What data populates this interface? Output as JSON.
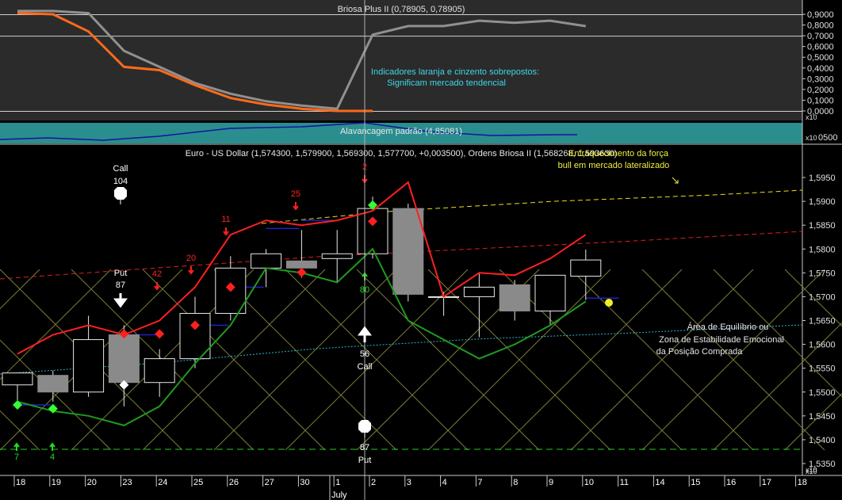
{
  "top_panel": {
    "title": "Briosa Plus II (0,78905, 0,78905)",
    "y_ticks": [
      "0,9000",
      "0,8000",
      "0,7000",
      "0,6000",
      "0,5000",
      "0,4000",
      "0,3000",
      "0,2000",
      "0,1000",
      "0,0000"
    ],
    "note_line1": "Indicadores laranja e cinzento sobrepostos:",
    "note_line2": "Significam mercado tendencial",
    "scale_tag": "x10"
  },
  "mid_panel": {
    "title": "Alavancagem padrão (4,85081)",
    "y_tick": "0500",
    "scale_tag": "x10"
  },
  "main_panel": {
    "title": "Euro - US Dollar (1,574300, 1,579900, 1,569300, 1,577700, +0,003500), Ordens Briosa II (1,568268, 1,593630)",
    "overlay_note_line1": "Enfraquecimento da força",
    "overlay_note_line2": "bull em mercado lateralizado",
    "zone_note_line1": "Área de Equilíbrio ou",
    "zone_note_line2": "Zona de Estabilidade Emocional",
    "zone_note_line3": "da Posição Comprada",
    "y_ticks": [
      "1,5950",
      "1,5900",
      "1,5850",
      "1,5800",
      "1,5750",
      "1,5700",
      "1,5650",
      "1,5600",
      "1,5550",
      "1,5500",
      "1,5450",
      "1,5400",
      "1,5350"
    ],
    "scale_tag": "x10",
    "signals": {
      "call_104_a": "Call",
      "call_104_b": "104",
      "put_87_a": "Put",
      "put_87_b": "87",
      "call_56_a": "56",
      "call_56_b": "Call",
      "put_87b_a": "87",
      "put_87b_b": "Put",
      "n7": "7",
      "n4": "4",
      "n80": "80",
      "n2": "2",
      "n11": "11",
      "n20": "20",
      "n25": "25",
      "n42": "42"
    }
  },
  "x_axis": {
    "labels": [
      "18",
      "19",
      "20",
      "23",
      "24",
      "25",
      "26",
      "27",
      "30",
      "1",
      "2",
      "3",
      "4",
      "7",
      "8",
      "9",
      "10",
      "11",
      "14",
      "15",
      "16",
      "17",
      "18"
    ],
    "month": "July",
    "scale_tag": "x10"
  },
  "colors": {
    "red_line": "#ff2020",
    "green_line": "#1f9a1f",
    "orange": "#ff6a1a",
    "gray": "#909090",
    "teal_band": "#1e8a8a",
    "blue_line": "#1a1aa0",
    "yellow": "#e8e020"
  },
  "chart_data": {
    "type": "candlestick",
    "title": "Euro - US Dollar (1,574300, 1,579900, 1,569300, 1,577700, +0,003500), Ordens Briosa II (1,568268, 1,593630)",
    "categories": [
      "18",
      "19",
      "20",
      "23",
      "24",
      "25",
      "26",
      "27",
      "30",
      "1",
      "2",
      "3",
      "4",
      "7",
      "8",
      "9",
      "10"
    ],
    "ohlc": [
      {
        "o": 1.5515,
        "h": 1.554,
        "l": 1.547,
        "c": 1.554
      },
      {
        "o": 1.5535,
        "h": 1.5545,
        "l": 1.548,
        "c": 1.55
      },
      {
        "o": 1.55,
        "h": 1.566,
        "l": 1.549,
        "c": 1.561
      },
      {
        "o": 1.562,
        "h": 1.564,
        "l": 1.547,
        "c": 1.552
      },
      {
        "o": 1.552,
        "h": 1.559,
        "l": 1.549,
        "c": 1.557
      },
      {
        "o": 1.557,
        "h": 1.57,
        "l": 1.555,
        "c": 1.5665
      },
      {
        "o": 1.5665,
        "h": 1.5785,
        "l": 1.565,
        "c": 1.576
      },
      {
        "o": 1.576,
        "h": 1.58,
        "l": 1.572,
        "c": 1.579
      },
      {
        "o": 1.5775,
        "h": 1.584,
        "l": 1.574,
        "c": 1.576
      },
      {
        "o": 1.578,
        "h": 1.584,
        "l": 1.573,
        "c": 1.579
      },
      {
        "o": 1.579,
        "h": 1.591,
        "l": 1.578,
        "c": 1.5885
      },
      {
        "o": 1.5885,
        "h": 1.5895,
        "l": 1.569,
        "c": 1.5705
      },
      {
        "o": 1.57,
        "h": 1.571,
        "l": 1.566,
        "c": 1.57
      },
      {
        "o": 1.57,
        "h": 1.575,
        "l": 1.5615,
        "c": 1.572
      },
      {
        "o": 1.5725,
        "h": 1.5735,
        "l": 1.565,
        "c": 1.567
      },
      {
        "o": 1.567,
        "h": 1.5745,
        "l": 1.564,
        "c": 1.5745
      },
      {
        "o": 1.5743,
        "h": 1.5799,
        "l": 1.5693,
        "c": 1.5777
      }
    ],
    "ylim": [
      1.532,
      1.598
    ],
    "series": [
      {
        "name": "",
        "color": "#ff2020",
        "values": [
          1.558,
          1.562,
          1.564,
          1.562,
          1.565,
          1.572,
          1.583,
          1.586,
          1.585,
          1.586,
          1.588,
          1.594,
          1.57,
          1.575,
          1.5745,
          1.578,
          1.583
        ]
      },
      {
        "name": "",
        "color": "#1f9a1f",
        "values": [
          1.548,
          1.546,
          1.545,
          1.543,
          1.547,
          1.556,
          1.564,
          1.576,
          1.575,
          1.573,
          1.58,
          1.565,
          1.561,
          1.557,
          1.56,
          1.564,
          1.569
        ]
      }
    ],
    "top_series": [
      {
        "name": "",
        "color": "#909090",
        "values": [
          0.93,
          0.93,
          0.91,
          0.56,
          0.41,
          0.26,
          0.16,
          0.09,
          0.05,
          0.02,
          0.71,
          0.79,
          0.79,
          0.84,
          0.82,
          0.84,
          0.78905
        ]
      },
      {
        "name": "",
        "color": "#ff6a1a",
        "values": [
          0.91,
          0.9,
          0.74,
          0.41,
          0.38,
          0.24,
          0.12,
          0.06,
          0.02,
          0.0,
          0.0,
          null,
          null,
          null,
          null,
          null,
          null
        ]
      }
    ]
  }
}
